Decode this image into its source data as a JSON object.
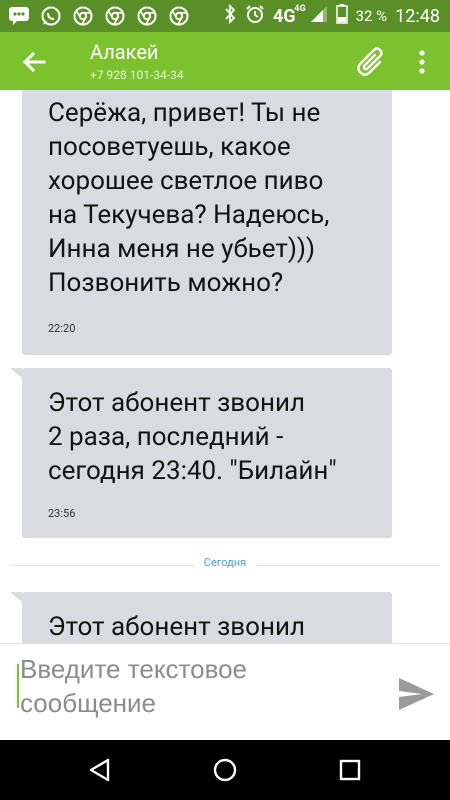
{
  "status_bar": {
    "network": "4G",
    "network_sup": "4G",
    "battery_percent": "32 %",
    "time": "12:48",
    "left_icons": [
      "chat-bubble-icon",
      "whatsapp-icon",
      "chrome-icon",
      "chrome-icon",
      "chrome-icon",
      "chrome-icon"
    ]
  },
  "header": {
    "contact_name": "Алакей",
    "contact_phone": "+7 928 101-34-34"
  },
  "messages": [
    {
      "text": "Серёжа, привет! Ты не\nпосоветуешь, какое\nхорошее светлое пиво\nна Текучева? Надеюсь,\nИнна меня не убьет)))\nПозвонить можно?",
      "time": "22:20"
    },
    {
      "text": "Этот абонент звонил\n2 раза, последний -\nсегодня 23:40. \"Билайн\"",
      "time": "23:56"
    },
    {
      "text": "Этот абонент звонил",
      "time": ""
    }
  ],
  "divider": {
    "label": "Сегодня"
  },
  "compose": {
    "placeholder": "Введите текстовое сообщение"
  },
  "colors": {
    "status_bar": "#5a8f27",
    "app_bar": "#7cc12e",
    "bubble": "#d9dbe0",
    "divider_label": "#4aa3d6"
  }
}
